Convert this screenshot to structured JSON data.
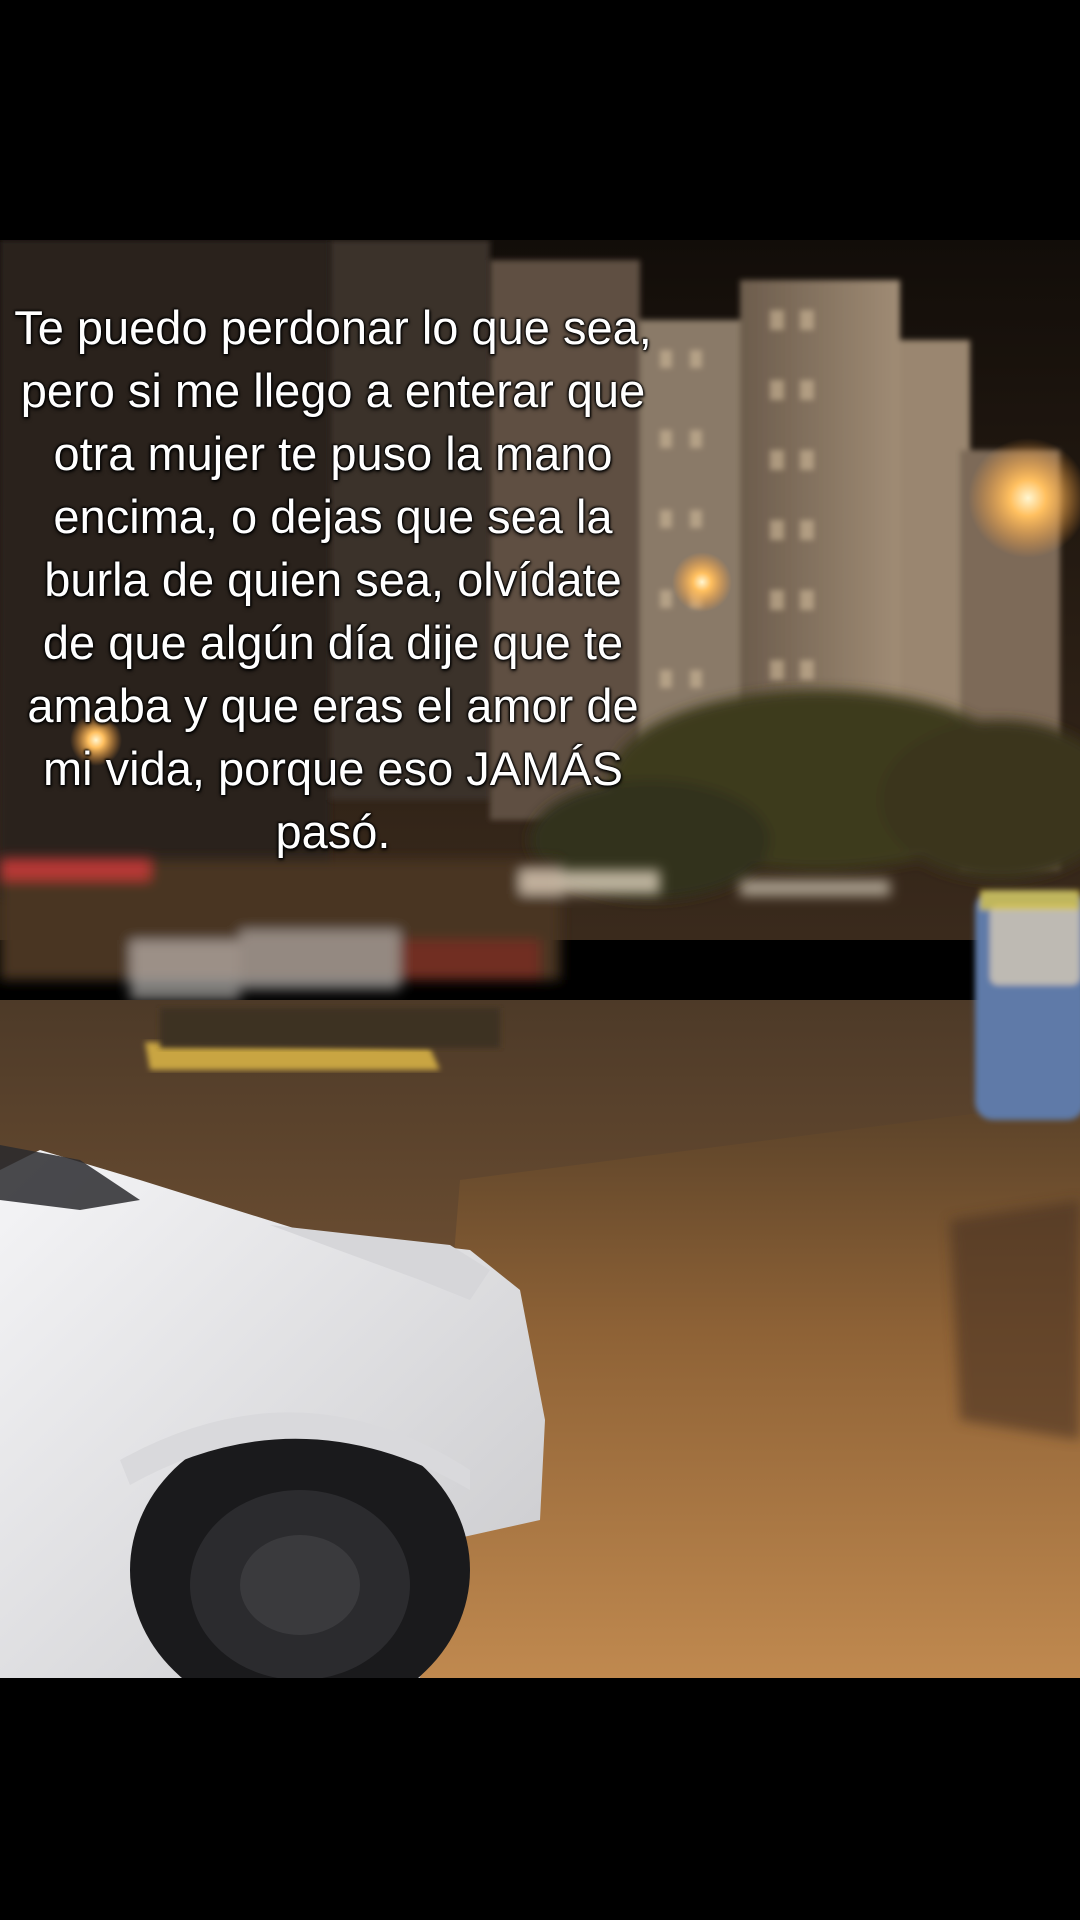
{
  "caption": {
    "text": "Te puedo perdonar lo que sea, pero si me llego a enterar que otra mujer te puso la mano encima, o dejas que sea la burla de quien sea, olvídate de que algún día dije que te amaba y que eras el amor de mi vida, porque eso JAMÁS pasó."
  },
  "scene": {
    "sky_color": "#1e1610",
    "building_color": "#8a7966",
    "street_light_color": "#ffb347",
    "pavement_color": "#b27a45",
    "car_color": "#e8e8ea",
    "trees_color": "#3d3a1c",
    "bus_color": "#5b79b0"
  }
}
